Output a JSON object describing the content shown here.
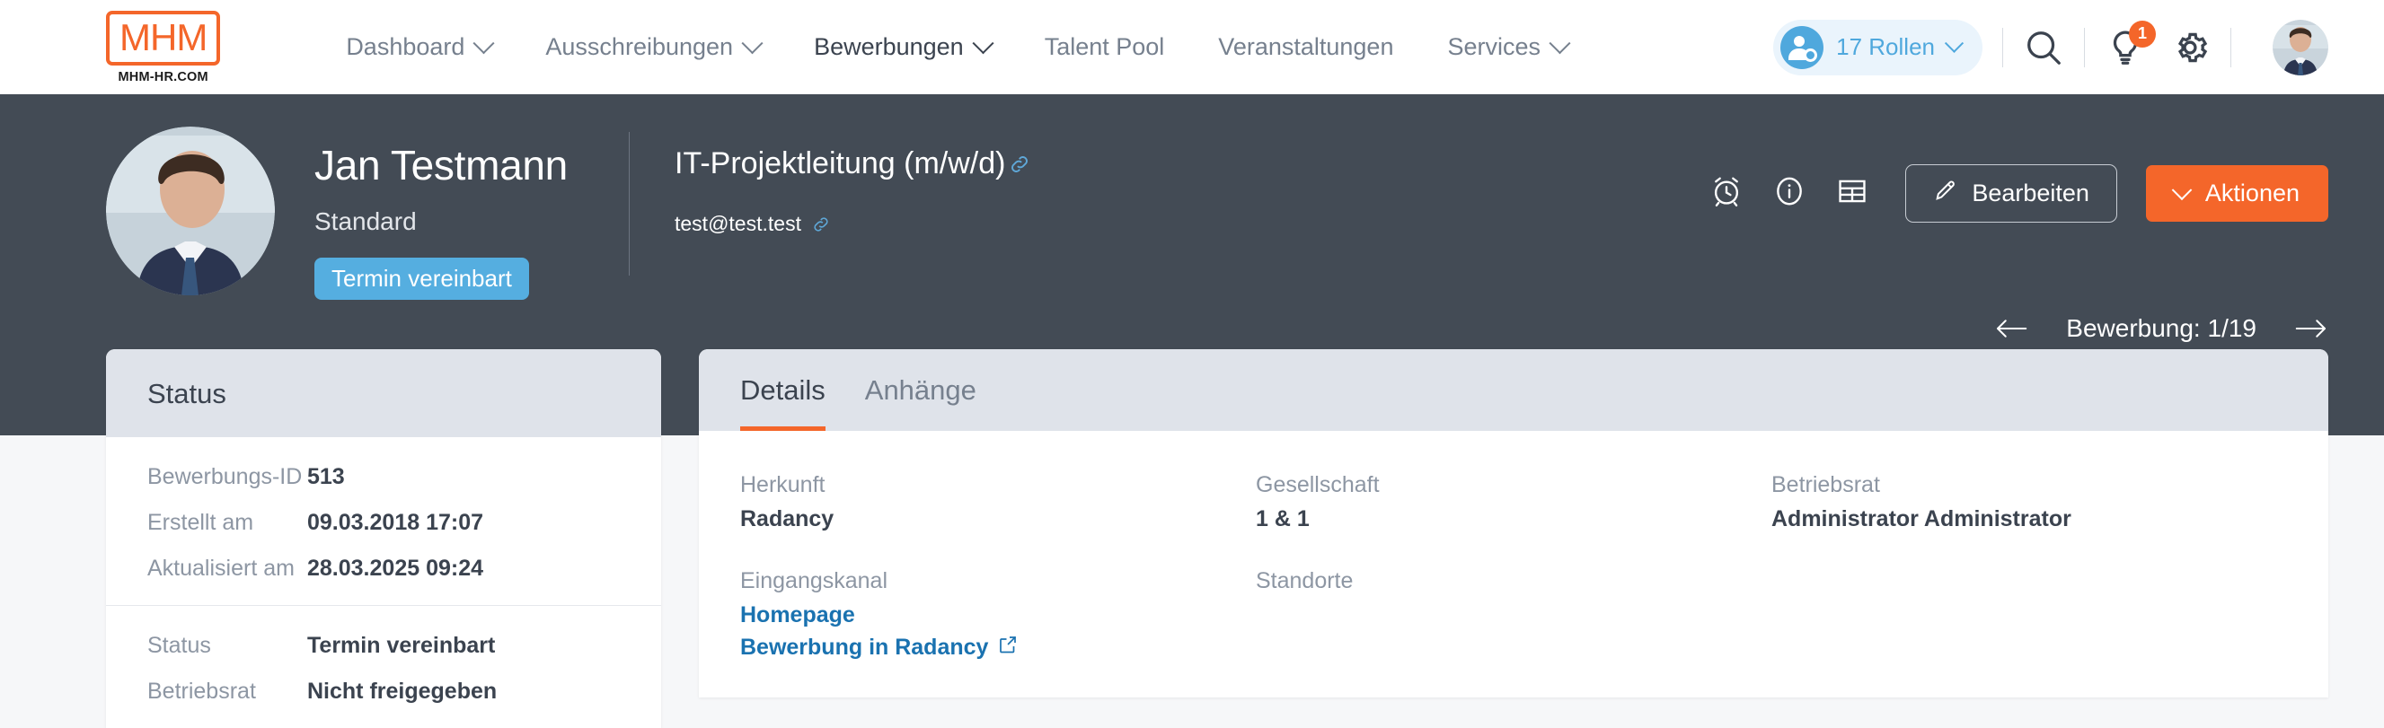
{
  "brand": {
    "logo_text": "MHM",
    "logo_caption": "MHM-HR.COM",
    "accent_color": "#f4662a",
    "banner_color": "#434b55",
    "link_color": "#1a72b0",
    "badge_color": "#55aee0"
  },
  "nav": {
    "items": [
      {
        "label": "Dashboard",
        "has_chevron": true,
        "active": false
      },
      {
        "label": "Ausschreibungen",
        "has_chevron": true,
        "active": false
      },
      {
        "label": "Bewerbungen",
        "has_chevron": true,
        "active": true
      },
      {
        "label": "Talent Pool",
        "has_chevron": false,
        "active": false
      },
      {
        "label": "Veranstaltungen",
        "has_chevron": false,
        "active": false
      },
      {
        "label": "Services",
        "has_chevron": true,
        "active": false
      }
    ],
    "roles_pill": {
      "label": "17 Rollen",
      "icon": "user-gear-icon"
    },
    "icons": [
      {
        "name": "search-icon"
      },
      {
        "name": "lightbulb-icon",
        "badge": "1"
      },
      {
        "name": "gear-icon"
      }
    ],
    "avatar": "user-avatar"
  },
  "banner": {
    "person_name": "Jan Testmann",
    "person_type": "Standard",
    "status_badge": "Termin vereinbart",
    "job_title": "IT-Projektleitung (m/w/d)",
    "email": "test@test.test",
    "icons": [
      {
        "name": "alarm-clock-icon"
      },
      {
        "name": "info-circle-icon"
      },
      {
        "name": "table-icon"
      }
    ],
    "edit_button": "Bearbeiten",
    "actions_button": "Aktionen",
    "pager_label": "Bewerbung: 1/19"
  },
  "status_card": {
    "title": "Status",
    "groups": [
      {
        "rows": [
          {
            "key": "Bewerbungs-ID",
            "value": "513"
          },
          {
            "key": "Erstellt am",
            "value": "09.03.2018 17:07"
          },
          {
            "key": "Aktualisiert am",
            "value": "28.03.2025 09:24"
          }
        ]
      },
      {
        "rows": [
          {
            "key": "Status",
            "value": "Termin vereinbart"
          },
          {
            "key": "Betriebsrat",
            "value": "Nicht freigegeben"
          }
        ]
      }
    ]
  },
  "main_card": {
    "tabs": [
      {
        "label": "Details",
        "active": true
      },
      {
        "label": "Anhänge",
        "active": false
      }
    ],
    "columns": [
      {
        "fields": [
          {
            "label": "Herkunft",
            "value": "Radancy",
            "type": "text"
          },
          {
            "label": "Eingangskanal",
            "type": "links",
            "links": [
              {
                "text": "Homepage",
                "external": false
              },
              {
                "text": "Bewerbung in Radancy",
                "external": true
              }
            ]
          }
        ]
      },
      {
        "fields": [
          {
            "label": "Gesellschaft",
            "value": "1 & 1",
            "type": "text"
          },
          {
            "label": "Standorte",
            "value": "",
            "type": "text"
          }
        ]
      },
      {
        "fields": [
          {
            "label": "Betriebsrat",
            "value": "Administrator Administrator",
            "type": "text"
          }
        ]
      }
    ]
  }
}
